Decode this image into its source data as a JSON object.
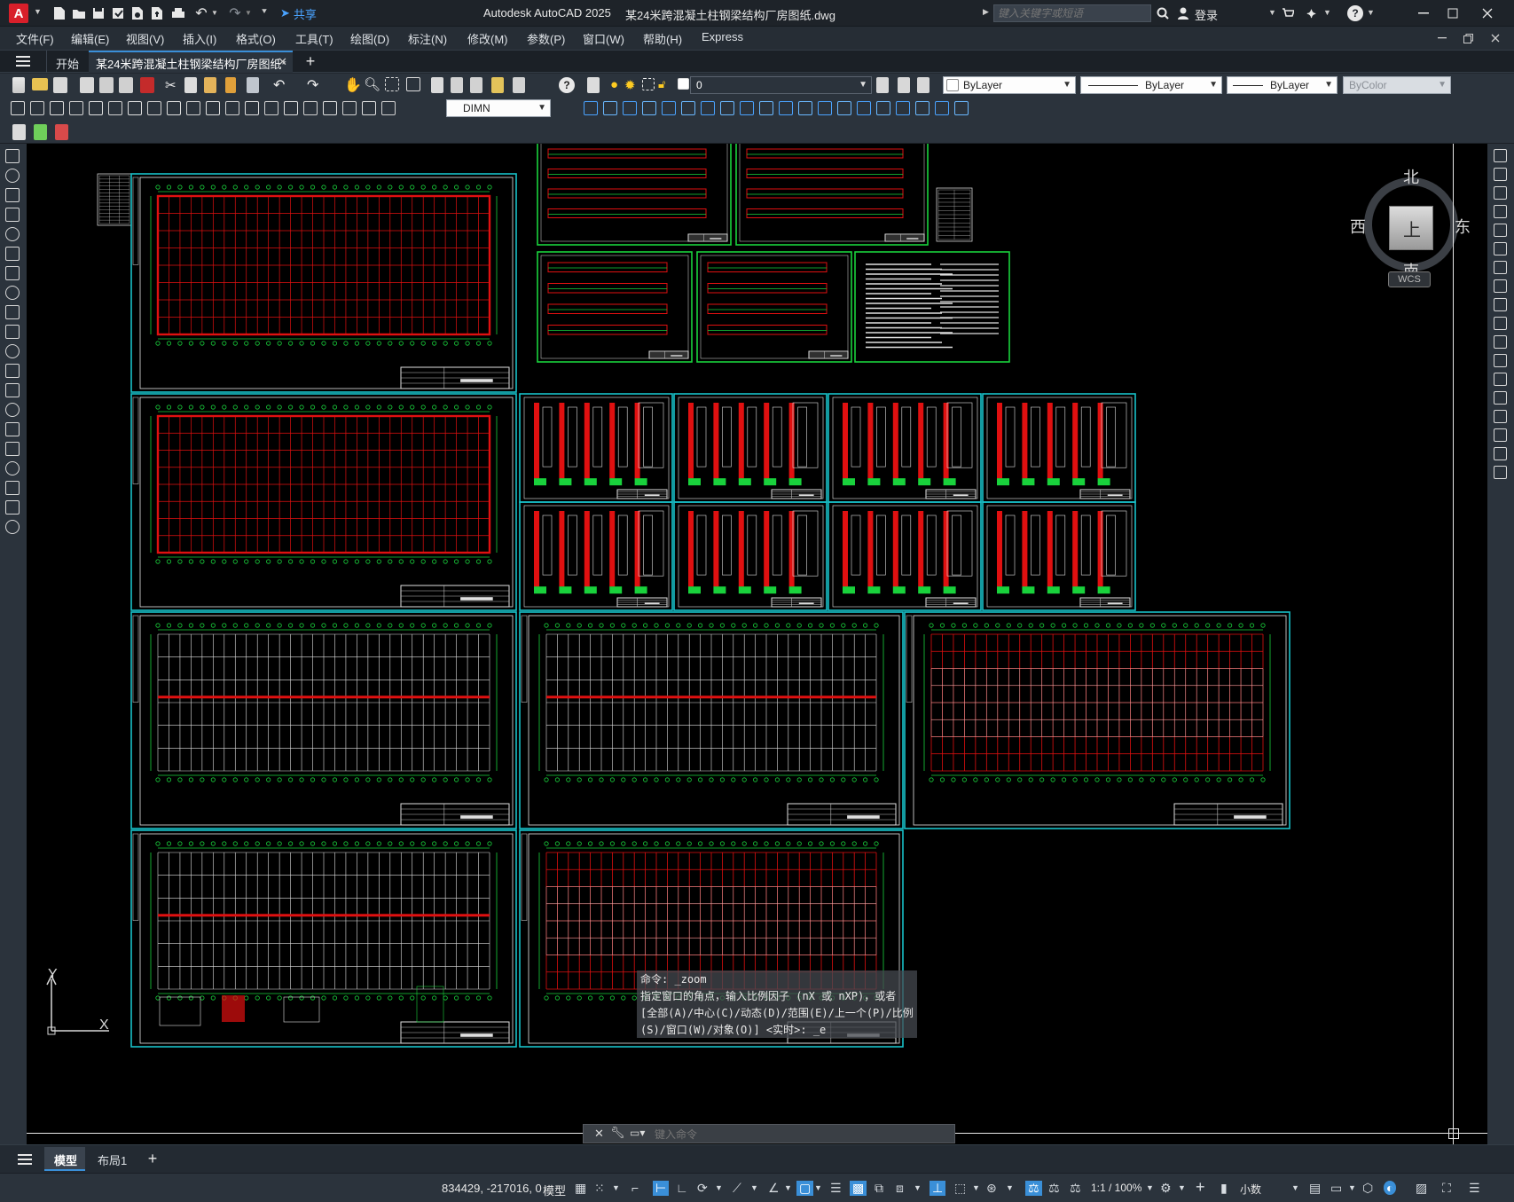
{
  "window": {
    "app_logo": "A",
    "app_title": "Autodesk AutoCAD 2025",
    "file_title": "某24米跨混凝土柱钢梁结构厂房图纸.dwg",
    "share_label": "共享",
    "search_placeholder": "键入关键字或短语",
    "login_label": "登录"
  },
  "menu": {
    "items": [
      "文件(F)",
      "编辑(E)",
      "视图(V)",
      "插入(I)",
      "格式(O)",
      "工具(T)",
      "绘图(D)",
      "标注(N)",
      "修改(M)",
      "参数(P)",
      "窗口(W)",
      "帮助(H)",
      "Express"
    ]
  },
  "doc_tabs": {
    "start_label": "开始",
    "active_tab": "某24米跨混凝土柱钢梁结构厂房图纸*",
    "new_tab_symbol": "+"
  },
  "toolbar": {
    "layer_value": "0",
    "dim_style": "DIMN",
    "color_value": "ByLayer",
    "linetype_value": "ByLayer",
    "lineweight_value": "ByLayer",
    "plotstyle_value": "ByColor"
  },
  "viewcube": {
    "north": "北",
    "south": "南",
    "east": "东",
    "west": "西",
    "face": "上",
    "wcs": "WCS"
  },
  "ucs": {
    "x": "X",
    "y": "Y"
  },
  "command": {
    "history": [
      "命令:  _zoom",
      "指定窗口的角点，输入比例因子 (nX 或 nXP)，或者",
      "[全部(A)/中心(C)/动态(D)/范围(E)/上一个(P)/比例",
      "(S)/窗口(W)/对象(O)] <实时>: _e"
    ],
    "placeholder": "键入命令"
  },
  "layout_tabs": {
    "model": "模型",
    "layout1": "布局1",
    "add": "+"
  },
  "status": {
    "coords": "834429, -217016, 0",
    "model_label": "模型",
    "scale": "1:1 / 100%",
    "units": "小数"
  },
  "colors": {
    "accent_red": "#d81f2a",
    "cad_cyan": "#18c0c8",
    "cad_green": "#19d23c",
    "cad_red": "#e01010"
  }
}
